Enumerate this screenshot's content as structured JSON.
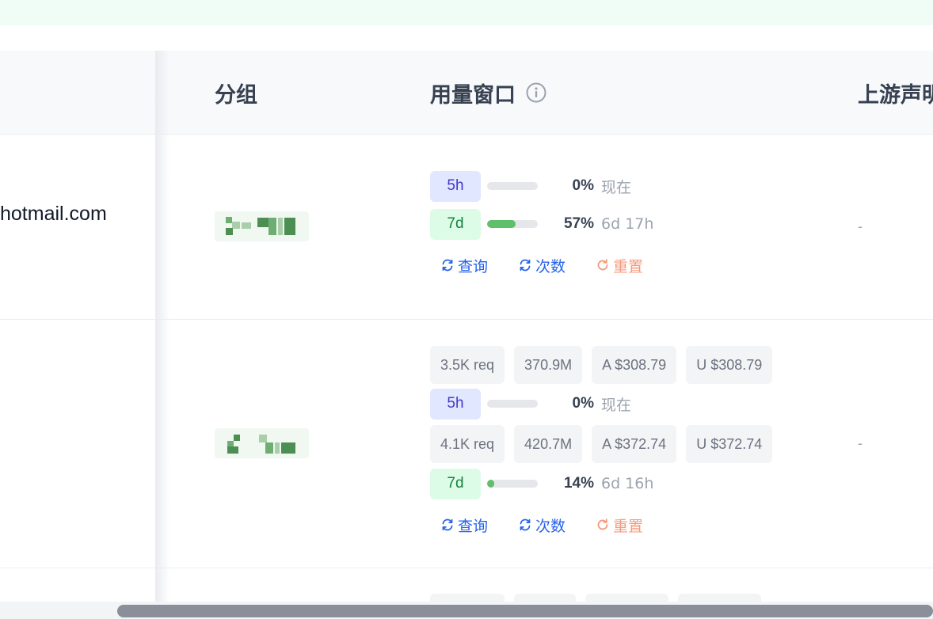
{
  "header": {
    "group_label": "分组",
    "usage_label": "用量窗口",
    "upstream_label": "上游声明"
  },
  "rows": [
    {
      "email": "hotmail.com",
      "windows": [
        {
          "period": "5h",
          "percent": "0%",
          "percent_value": 0,
          "reset": "现在"
        },
        {
          "period": "7d",
          "percent": "57%",
          "percent_value": 57,
          "reset": "6d 17h"
        }
      ],
      "actions": {
        "query": "查询",
        "count": "次数",
        "reset": "重置"
      },
      "upstream": "-"
    },
    {
      "windows": [
        {
          "stats": [
            "3.5K req",
            "370.9M",
            "A $308.79",
            "U $308.79"
          ],
          "period": "5h",
          "percent": "0%",
          "percent_value": 0,
          "reset": "现在"
        },
        {
          "stats": [
            "4.1K req",
            "420.7M",
            "A $372.74",
            "U $372.74"
          ],
          "period": "7d",
          "percent": "14%",
          "percent_value": 14,
          "reset": "6d 16h"
        }
      ],
      "actions": {
        "query": "查询",
        "count": "次数",
        "reset": "重置"
      },
      "upstream": "-"
    }
  ],
  "colors": {
    "blue_action": "#2563eb",
    "reset_action": "#f59a7a",
    "progress_fill": "#5fbf6a",
    "badge_5h_bg": "#e0e7ff",
    "badge_7d_bg": "#dcfce7"
  }
}
